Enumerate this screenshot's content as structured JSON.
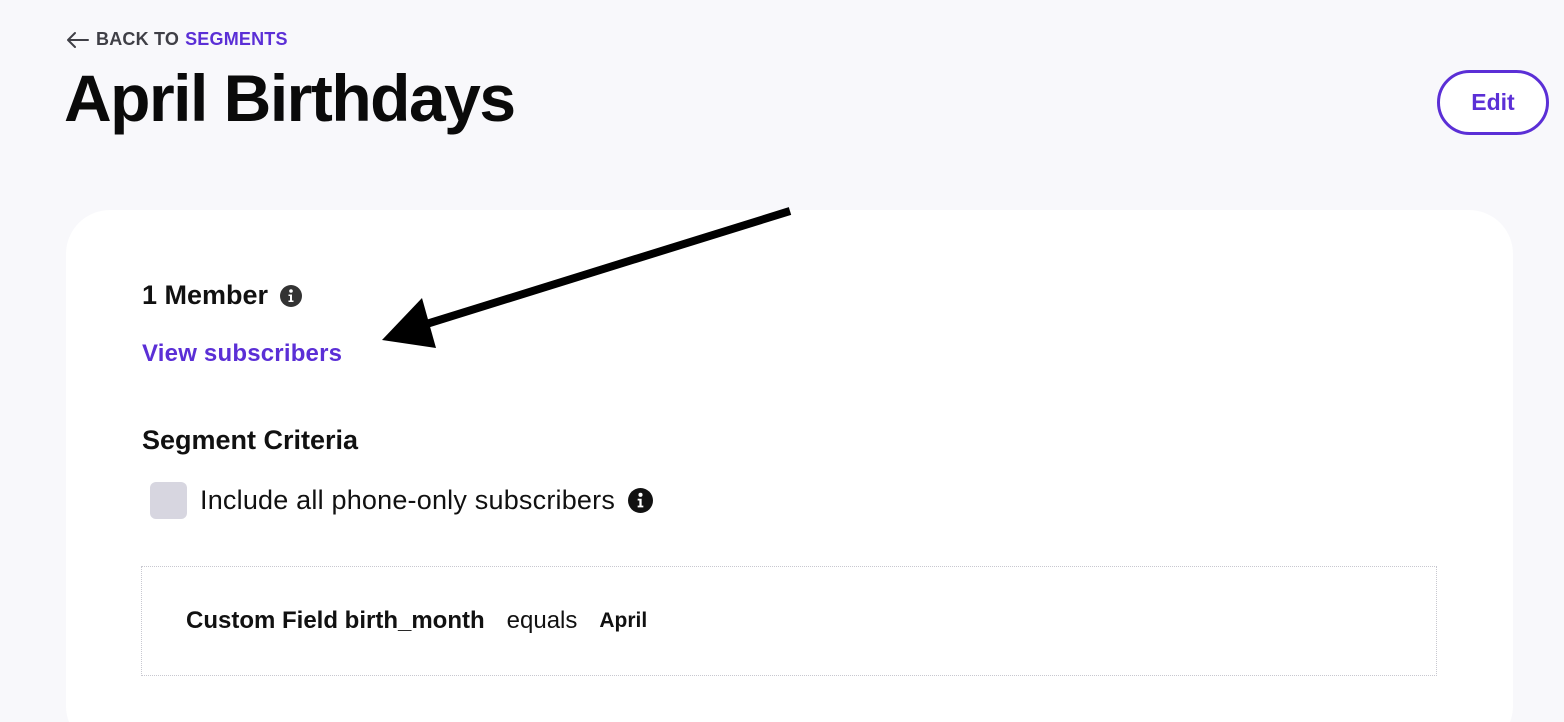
{
  "nav": {
    "back_prefix": "BACK TO",
    "back_target": "SEGMENTS",
    "back_icon": "arrow-left-icon"
  },
  "header": {
    "title": "April Birthdays",
    "edit_label": "Edit"
  },
  "summary": {
    "member_count": "1 Member",
    "info_icon": "info-icon",
    "view_subscribers_label": "View subscribers"
  },
  "criteria": {
    "heading": "Segment Criteria",
    "phone_only_label": "Include all phone-only subscribers",
    "phone_only_checked": false,
    "rules": [
      {
        "field": "Custom Field birth_month",
        "operator": "equals",
        "value": "April"
      }
    ]
  },
  "colors": {
    "accent": "#5b2fd6",
    "background": "#f8f8fb",
    "card": "#ffffff",
    "checkbox": "#d7d6e0"
  }
}
